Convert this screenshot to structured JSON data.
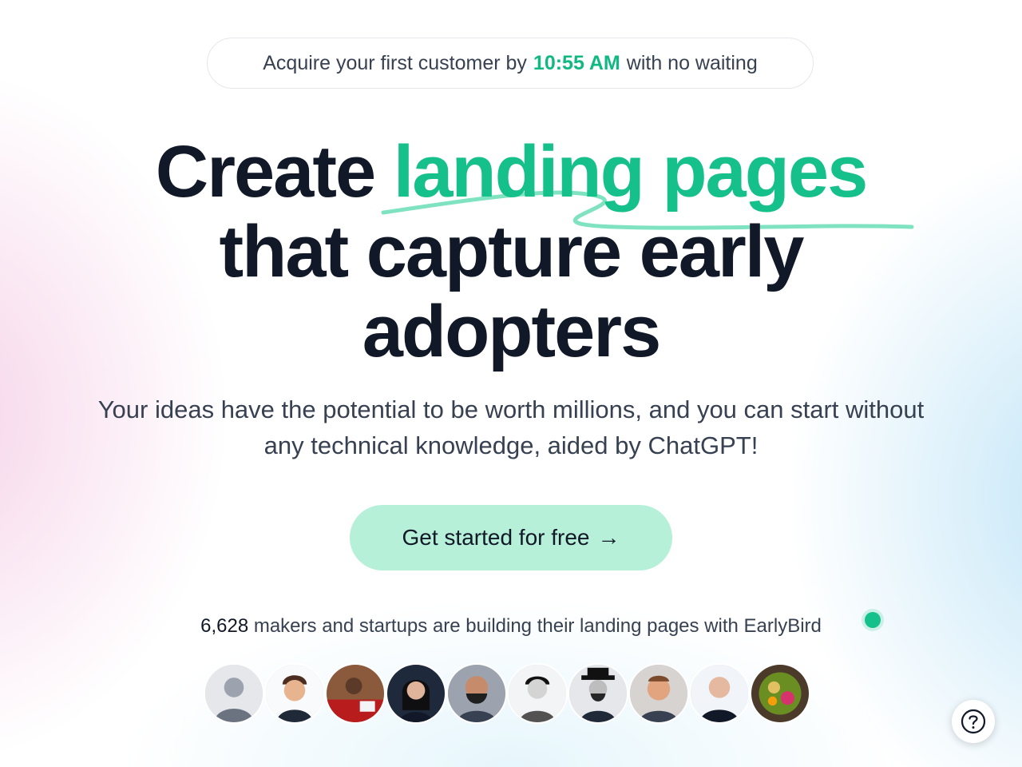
{
  "banner": {
    "prefix": "Acquire your first customer by",
    "time": "10:55 AM",
    "suffix": "with no waiting"
  },
  "hero": {
    "title_line1_dark": "Create",
    "title_line1_accent": "landing pages",
    "title_line2": "that capture early",
    "title_line3": "adopters",
    "subtitle_line1": "Your ideas have the potential to be worth millions, and you can start without",
    "subtitle_line2": "any technical knowledge, aided by ChatGPT!"
  },
  "cta": {
    "label": "Get started for free",
    "arrow": "→"
  },
  "stats": {
    "count": "6,628",
    "text": "makers and startups are building their landing pages with EarlyBird"
  },
  "avatars": [
    {
      "icon": "user-avatar-1"
    },
    {
      "icon": "user-avatar-2"
    },
    {
      "icon": "user-avatar-3"
    },
    {
      "icon": "user-avatar-4"
    },
    {
      "icon": "user-avatar-5"
    },
    {
      "icon": "user-avatar-6"
    },
    {
      "icon": "user-avatar-7"
    },
    {
      "icon": "user-avatar-8"
    },
    {
      "icon": "user-avatar-9"
    },
    {
      "icon": "food-bowl-avatar"
    }
  ],
  "colors": {
    "accent": "#16c08a",
    "cta_background": "#b6f0d9",
    "heading": "#111827",
    "body_text": "#374151"
  },
  "help": {
    "icon": "question-mark-icon"
  }
}
